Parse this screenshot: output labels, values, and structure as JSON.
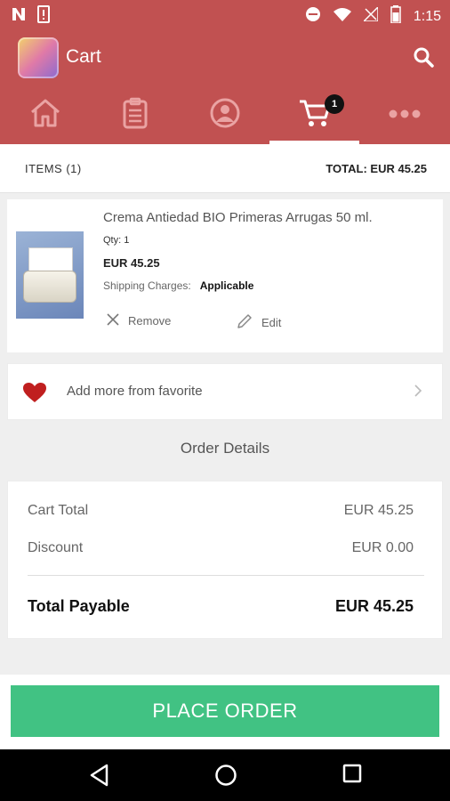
{
  "status_bar": {
    "time": "1:15"
  },
  "app_bar": {
    "title": "Cart"
  },
  "tabs": [
    {
      "name": "home",
      "icon": "home-icon"
    },
    {
      "name": "orders",
      "icon": "clipboard-icon"
    },
    {
      "name": "account",
      "icon": "user-icon"
    },
    {
      "name": "cart",
      "icon": "cart-icon",
      "badge": "1",
      "active": true
    },
    {
      "name": "more",
      "icon": "more-icon"
    }
  ],
  "summary": {
    "items_label": "ITEMS (1)",
    "total_label": "TOTAL: EUR 45.25"
  },
  "cart_item": {
    "name": "Crema Antiedad BIO Primeras Arrugas 50 ml.",
    "qty": "Qty: 1",
    "price": "EUR 45.25",
    "shipping_label": "Shipping Charges:",
    "shipping_value": "Applicable",
    "remove_label": "Remove",
    "edit_label": "Edit"
  },
  "favorite": {
    "label": "Add more from favorite"
  },
  "order_details": {
    "title": "Order Details",
    "cart_total_label": "Cart Total",
    "cart_total_value": "EUR 45.25",
    "discount_label": "Discount",
    "discount_value": "EUR 0.00",
    "total_payable_label": "Total Payable",
    "total_payable_value": "EUR 45.25"
  },
  "place_order": {
    "label": "PLACE ORDER"
  },
  "colors": {
    "brand": "#c15151",
    "accent_button": "#41c283"
  }
}
